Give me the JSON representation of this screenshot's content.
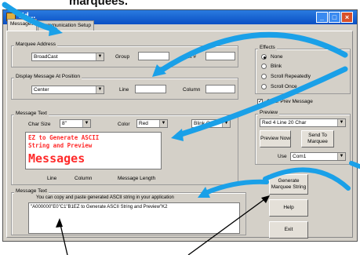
{
  "caption": "marquees.",
  "window": {
    "title": "Ed..."
  },
  "tabs": [
    {
      "label": "Messages"
    },
    {
      "label": "Communication Setup"
    }
  ],
  "marquee_address": {
    "group_label": "Marquee Address",
    "address_value": "BroadCast",
    "group_field_label": "Group",
    "unit_label": "Unit #"
  },
  "display_position": {
    "group_label": "Display Message At Position",
    "position_value": "Center",
    "line_label": "Line",
    "column_label": "Column"
  },
  "message_text": {
    "group_label": "Message Text",
    "char_size_label": "Char Size",
    "char_size_value": "8\"",
    "color_label": "Color",
    "color_value": "Red",
    "blink_value": "Blink Off",
    "preview_lines": [
      "EZ to Generate ASCII",
      "String and Preview",
      "Messages"
    ],
    "line_label": "Line",
    "column_label": "Column",
    "length_label": "Message Length"
  },
  "effects": {
    "group_label": "Effects",
    "options": [
      "None",
      "Blink",
      "Scroll Repeatedly",
      "Scroll Once"
    ],
    "selected_index": 0
  },
  "preview": {
    "clear_prev_label": "Clear Prev Message",
    "clear_prev_checked": true,
    "group_label": "Preview",
    "device_value": "Red 4 Line 20 Char",
    "preview_now_label": "Preview Now",
    "send_label": "Send To Marquee",
    "use_label": "Use",
    "use_value": "Com1"
  },
  "output": {
    "group_label": "Message Text",
    "instruction": "You can copy and paste generated ASCII string in your application",
    "ascii_string": "\"A000000\"E0\"C1\"B1EZ to Generate ASCII String and Preview\"K2"
  },
  "buttons": {
    "generate_label": "Generate Marquee String",
    "help_label": "Help",
    "exit_label": "Exit"
  },
  "colors": {
    "arrow_blue": "#1aa0e8",
    "preview_red": "#ff2a2a",
    "titlebar_blue": "#0a4fc4"
  }
}
